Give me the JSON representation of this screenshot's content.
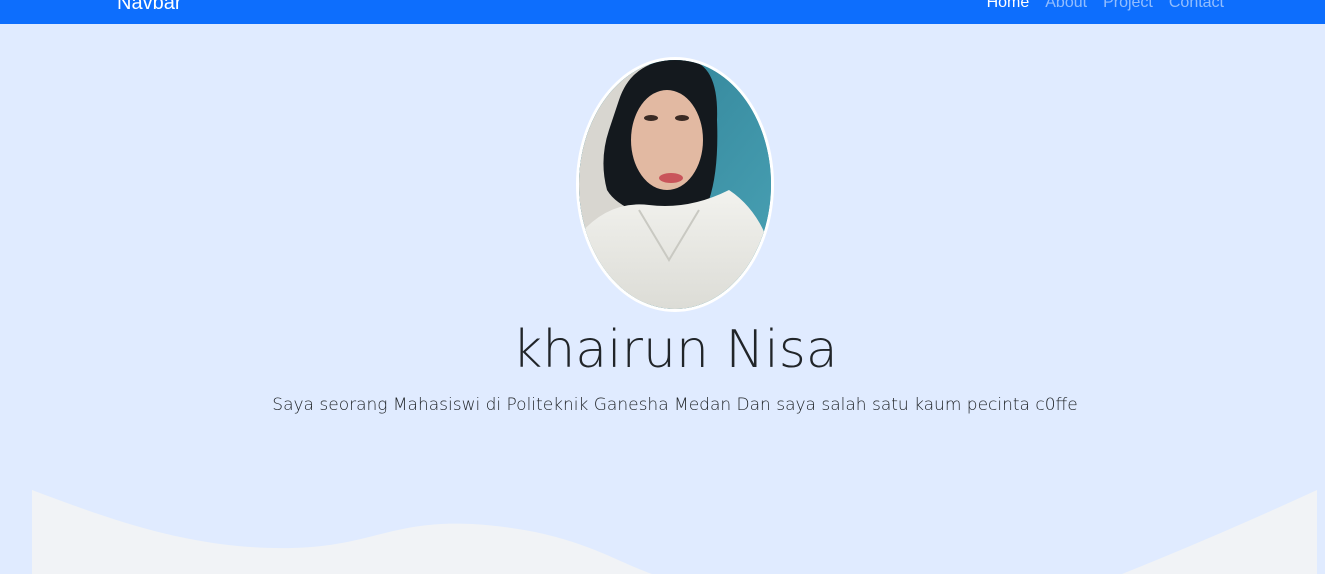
{
  "navbar": {
    "brand": "Navbar",
    "links": [
      {
        "label": "Home",
        "active": true
      },
      {
        "label": "About",
        "active": false
      },
      {
        "label": "Project",
        "active": false
      },
      {
        "label": "Contact",
        "active": false
      }
    ]
  },
  "hero": {
    "name": "khairun Nisa",
    "tagline": "Saya seorang Mahasiswi di Politeknik Ganesha Medan Dan saya salah satu kaum pecinta c0ffe"
  },
  "colors": {
    "navbar_bg": "#0d6efd",
    "hero_bg": "#e0ebff",
    "wave_fill": "#f1f3f6",
    "text": "#212529"
  },
  "icons": [
    "profile-photo"
  ]
}
